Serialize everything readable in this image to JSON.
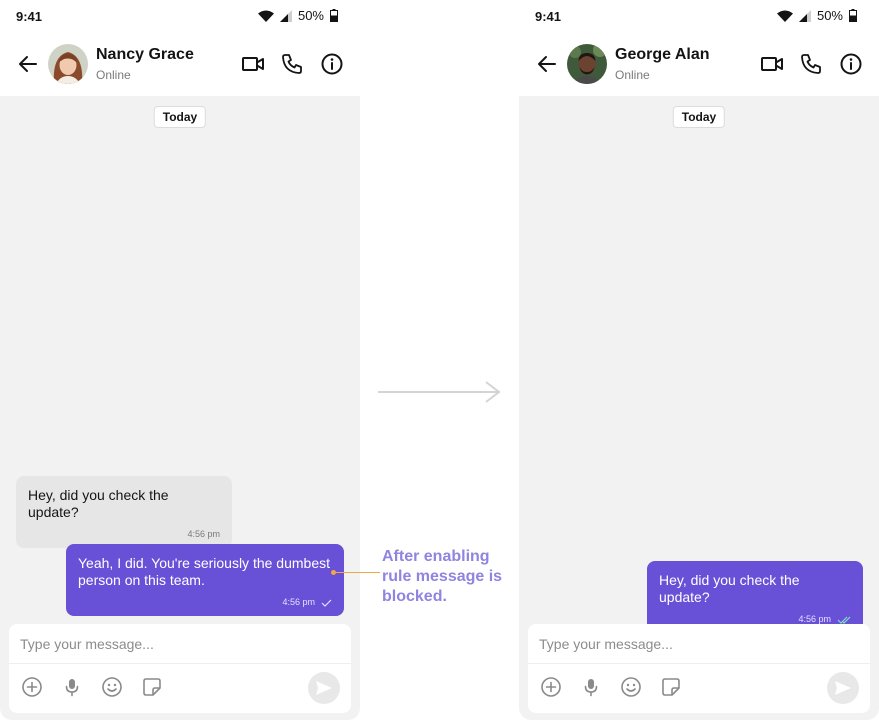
{
  "left_phone": {
    "status_time": "9:41",
    "battery": "50%",
    "contact_name": "Nancy Grace",
    "contact_status": "Online",
    "date_chip": "Today",
    "incoming": {
      "text": "Hey, did you check the update?",
      "time": "4:56 pm"
    },
    "outgoing": {
      "text": "Yeah, I did. You're seriously the dumbest person on this team.",
      "time": "4:56 pm",
      "receipt": "sent"
    },
    "composer_placeholder": "Type your message..."
  },
  "right_phone": {
    "status_time": "9:41",
    "battery": "50%",
    "contact_name": "George Alan",
    "contact_status": "Online",
    "date_chip": "Today",
    "outgoing": {
      "text": "Hey, did you check the update?",
      "time": "4:56 pm",
      "receipt": "delivered"
    },
    "composer_placeholder": "Type your message..."
  },
  "annotation": {
    "text": "After enabling rule message is blocked."
  },
  "icons": {
    "header": [
      "back-arrow-icon",
      "video-call-icon",
      "phone-icon",
      "info-icon"
    ],
    "composer": [
      "plus-circle-icon",
      "microphone-icon",
      "emoji-icon",
      "sticker-icon",
      "send-icon"
    ],
    "status": [
      "wifi-icon",
      "signal-icon",
      "battery-icon"
    ]
  },
  "colors": {
    "outgoing_bubble": "#6851d6",
    "incoming_bubble": "#e6e6e6",
    "chat_background": "#f2f2f2",
    "annotation_text": "#8f84e0",
    "annotation_line": "#f0a844",
    "delivered_check": "#7ee0c0"
  }
}
